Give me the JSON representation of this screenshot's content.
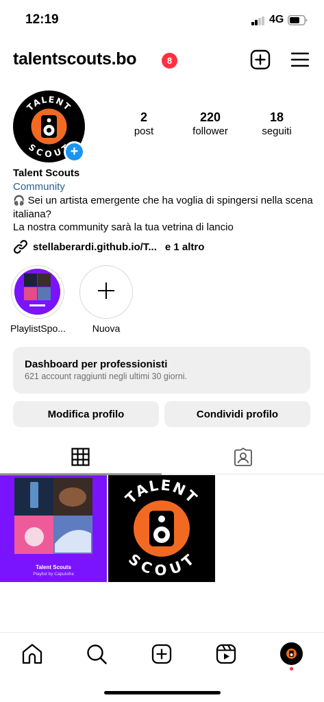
{
  "status_bar": {
    "time": "12:19",
    "network": "4G"
  },
  "header": {
    "username": "talentscouts.bo",
    "notification_count": "8",
    "icons": [
      "add-post-icon",
      "menu-icon"
    ]
  },
  "profile": {
    "stats": [
      {
        "value": "2",
        "label": "post"
      },
      {
        "value": "220",
        "label": "follower"
      },
      {
        "value": "18",
        "label": "seguiti"
      }
    ],
    "avatar_logo_text": [
      "TALENT",
      "SCOUT"
    ]
  },
  "bio": {
    "name": "Talent Scouts",
    "category": "Community",
    "emoji": "🎧",
    "line1": "Sei un artista emergente che ha voglia di spingersi nella scena italiana?",
    "line2": "La nostra community sarà la tua vetrina di lancio",
    "link": "stellaberardi.github.io/T...",
    "link_extra": "e 1 altro"
  },
  "highlights": [
    {
      "label": "PlaylistSpo..."
    },
    {
      "label": "Nuova"
    }
  ],
  "dashboard": {
    "title": "Dashboard per professionisti",
    "subtitle": "621 account raggiunti negli ultimi 30 giorni."
  },
  "buttons": {
    "edit": "Modifica profilo",
    "share": "Condividi profilo"
  },
  "grid": {
    "playlist_title": "Talent Scouts",
    "playlist_subtitle": "Playlist by Caputofra",
    "logo_text": [
      "TALENT",
      "SCOUT"
    ]
  },
  "colors": {
    "accent_blue": "#1c95f0",
    "badge_red": "#ff3040",
    "playlist_purple": "#7a14ff",
    "logo_orange": "#f26a21",
    "category_blue": "#2b5d8b"
  }
}
